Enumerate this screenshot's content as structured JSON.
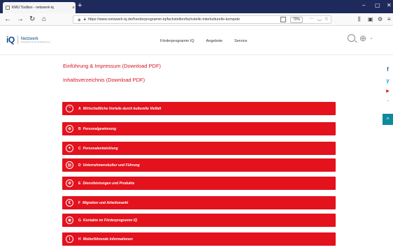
{
  "browser": {
    "tab_title": "KMU Toolbox - netzwerk-iq",
    "tab_close": "×",
    "new_tab": "+",
    "url": "https://www.netzwerk-iq.de/foerderprogramm-iq/fachstellen/fachstelle-interkulturelle-kompete",
    "zoom": "70%",
    "icons": {
      "back": "back-arrow-icon",
      "forward": "forward-arrow-icon",
      "reload": "reload-icon",
      "home": "home-icon"
    }
  },
  "site": {
    "logo_mark": "iQ",
    "logo_text": "Netzwerk",
    "logo_sub": "Integration durch Qualifizierung",
    "nav": [
      "Förderprogramm IQ",
      "Angebote",
      "Service"
    ]
  },
  "content": {
    "links": [
      "Einführung & Impressum (Download PDF)",
      "Inhaltsverzeichnis (Download PDF)"
    ],
    "chapters": [
      {
        "letter": "A",
        "label": "Wirtschaftliche Vorteile durch kulturelle Vielfalt",
        "icon_glyph": "⌃",
        "icon": "growth-icon"
      },
      {
        "letter": "B",
        "label": "Personalgewinnung",
        "icon_glyph": "⊕",
        "icon": "recruitment-icon"
      },
      {
        "letter": "C",
        "label": "Personalentwicklung",
        "icon_glyph": "✦",
        "icon": "development-icon"
      },
      {
        "letter": "D",
        "label": "Unternehmenskultur und Führung",
        "icon_glyph": "▤",
        "icon": "culture-icon"
      },
      {
        "letter": "E",
        "label": "Dienstleistungen und Produkte",
        "icon_glyph": "⊗",
        "icon": "services-icon"
      },
      {
        "letter": "F",
        "label": "Migration und Arbeitsmarkt",
        "icon_glyph": "€",
        "icon": "migration-icon"
      },
      {
        "letter": "G",
        "label": "Kontakte im Förderprogramm IQ",
        "icon_glyph": "◉",
        "icon": "contacts-icon"
      },
      {
        "letter": "H",
        "label": "Weiterführende Informationen",
        "icon_glyph": "i",
        "icon": "info-icon"
      }
    ]
  },
  "social": {
    "facebook": "f",
    "twitter": "y",
    "youtube": "▶",
    "rss": "◔",
    "to_top": "^"
  },
  "colors": {
    "accent_red": "#e3121d",
    "teal": "#0f8a9c",
    "tabbar": "#1f2a5c"
  }
}
